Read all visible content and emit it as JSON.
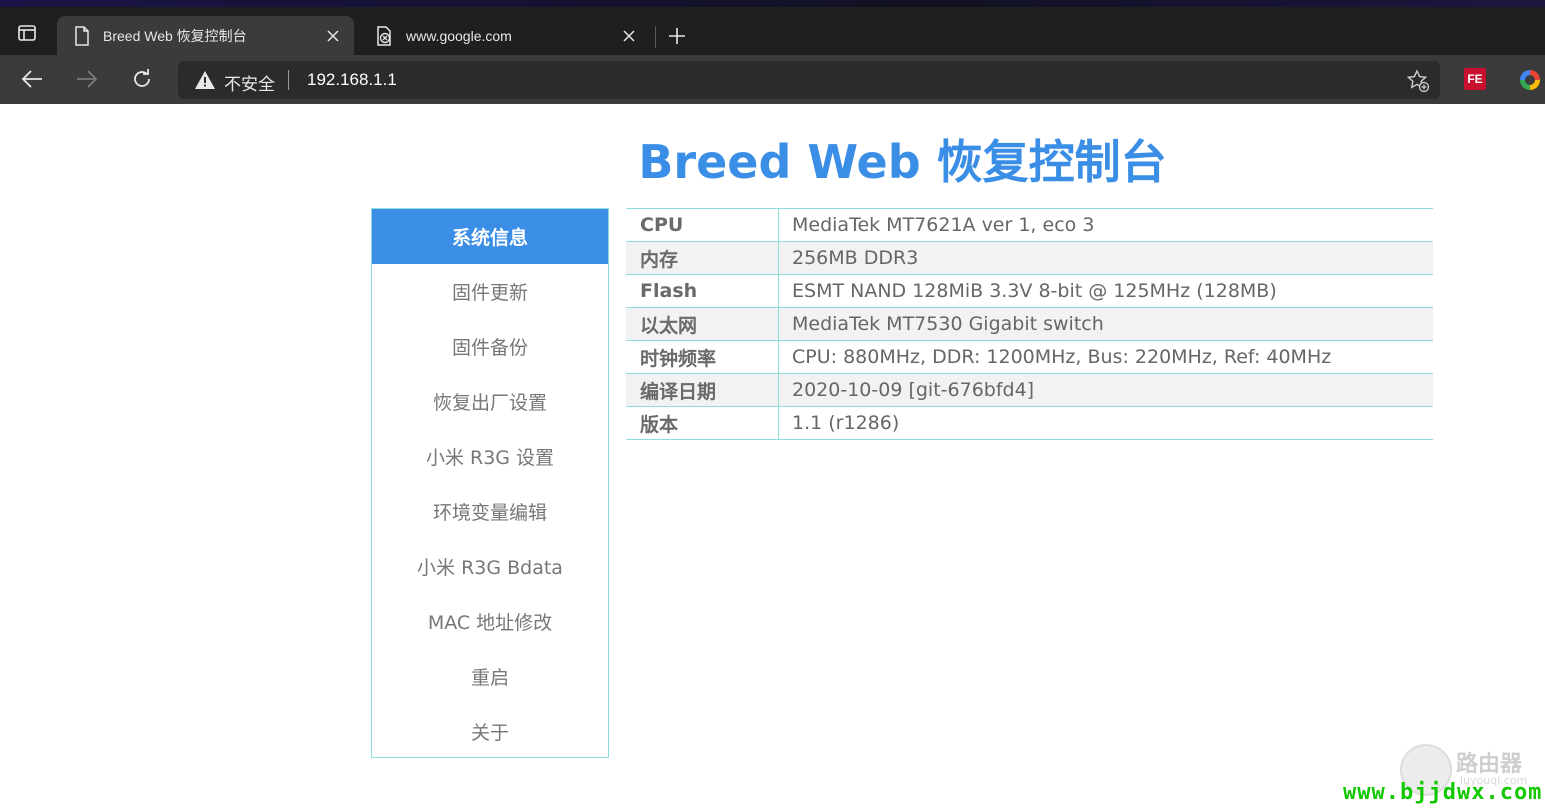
{
  "browser": {
    "tabs": [
      {
        "title": "Breed Web 恢复控制台",
        "active": true,
        "icon": "page-icon"
      },
      {
        "title": "www.google.com",
        "active": false,
        "icon": "blocked-page-icon"
      }
    ],
    "security_label": "不安全",
    "url": "192.168.1.1",
    "extensions": [
      {
        "name": "FE",
        "icon": "fe-helper-icon"
      },
      {
        "name": "",
        "icon": "color-picker-icon"
      }
    ]
  },
  "page": {
    "title": "Breed Web 恢复控制台",
    "accent_color": "#3a8ee6",
    "border_color": "#8fdede"
  },
  "nav": {
    "items": [
      {
        "label": "系统信息",
        "active": true
      },
      {
        "label": "固件更新",
        "active": false
      },
      {
        "label": "固件备份",
        "active": false
      },
      {
        "label": "恢复出厂设置",
        "active": false
      },
      {
        "label": "小米 R3G 设置",
        "active": false
      },
      {
        "label": "环境变量编辑",
        "active": false
      },
      {
        "label": "小米 R3G Bdata",
        "active": false
      },
      {
        "label": "MAC 地址修改",
        "active": false
      },
      {
        "label": "重启",
        "active": false
      },
      {
        "label": "关于",
        "active": false
      }
    ]
  },
  "info": {
    "rows": [
      {
        "key": "CPU",
        "value": "MediaTek MT7621A ver 1, eco 3"
      },
      {
        "key": "内存",
        "value": "256MB DDR3"
      },
      {
        "key": "Flash",
        "value": "ESMT NAND 128MiB 3.3V 8-bit @ 125MHz (128MB)"
      },
      {
        "key": "以太网",
        "value": "MediaTek MT7530 Gigabit switch"
      },
      {
        "key": "时钟频率",
        "value": "CPU: 880MHz, DDR: 1200MHz, Bus: 220MHz, Ref: 40MHz"
      },
      {
        "key": "编译日期",
        "value": "2020-10-09 [git-676bfd4]"
      },
      {
        "key": "版本",
        "value": "1.1 (r1286)"
      }
    ]
  },
  "watermark": {
    "brand": "路由器",
    "sub": "luyouqi.com",
    "url": "www.bjjdwx.com"
  }
}
